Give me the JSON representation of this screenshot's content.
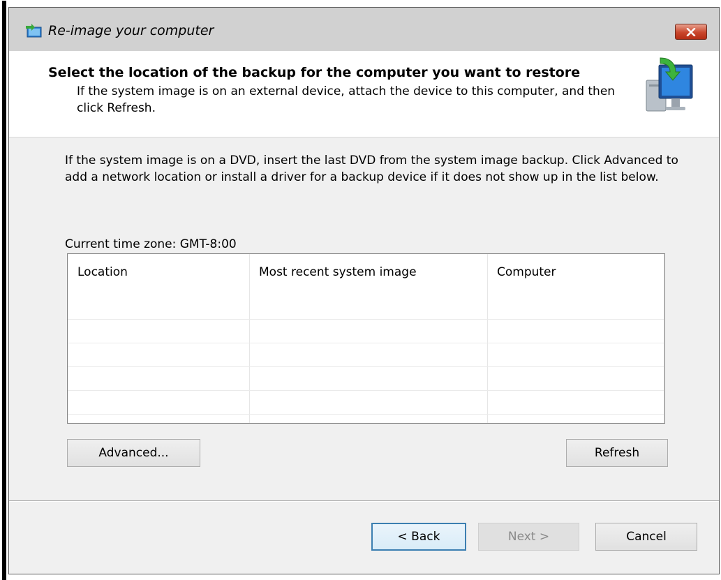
{
  "window": {
    "title": "Re-image your computer"
  },
  "header": {
    "title": "Select the location of the backup for the computer you want to restore",
    "description": "If the system image is on an external device, attach the device to this computer, and then click Refresh."
  },
  "body": {
    "instructions": "If the system image is on a DVD, insert the last DVD from the system image backup. Click Advanced to add a network location or install a driver for a backup device if it does not show up in the list below.",
    "timezone": "Current time zone: GMT-8:00"
  },
  "table": {
    "columns": [
      "Location",
      "Most recent system image",
      "Computer"
    ],
    "rows": []
  },
  "buttons": {
    "advanced": "Advanced...",
    "refresh": "Refresh",
    "back": "< Back",
    "next": "Next >",
    "cancel": "Cancel"
  },
  "icons": {
    "title": "backup-restore-icon",
    "header": "computer-restore-icon",
    "close": "close-icon"
  }
}
